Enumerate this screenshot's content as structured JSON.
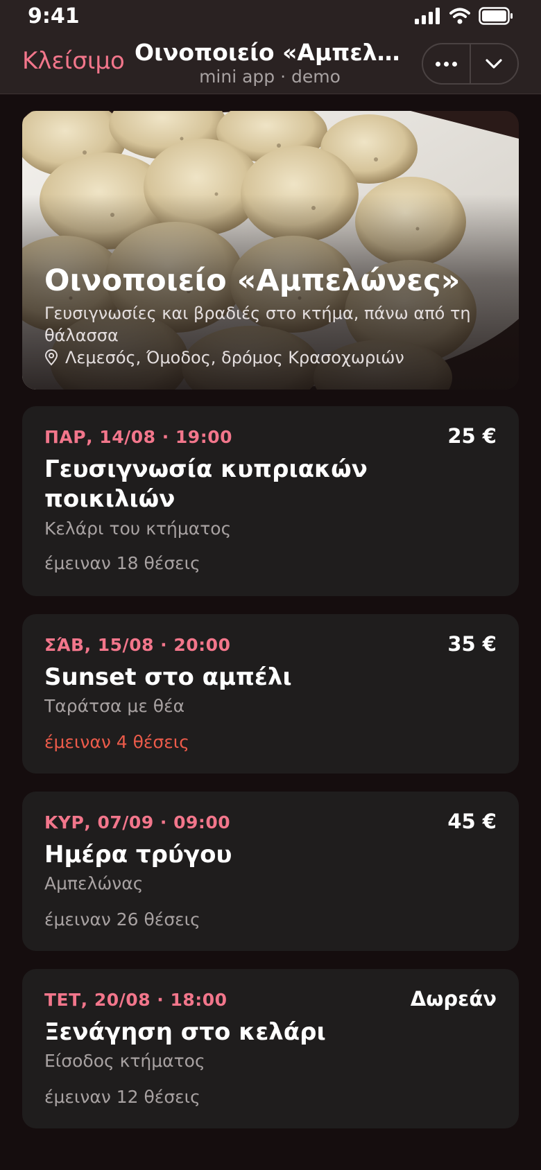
{
  "status_bar": {
    "time": "9:41"
  },
  "header": {
    "close_label": "Κλείσιμο",
    "title": "Οινοποιείο «Αμπελώνες»",
    "subtitle": "mini app · demo",
    "more_icon": "more-dots-icon",
    "collapse_icon": "chevron-down-icon"
  },
  "hero": {
    "title": "Οινοποιείο «Αμπελώνες»",
    "description": "Γευσιγνωσίες και βραδιές στο κτήμα, πάνω από τη θάλασσα",
    "location": "Λεμεσός, Όμοδος, δρόμος Κρασοχωριών",
    "location_icon": "map-pin-icon"
  },
  "events": [
    {
      "date": "ΠΑΡ, 14/08 · 19:00",
      "price": "25 €",
      "title": "Γευσιγνωσία κυπριακών ποικιλιών",
      "place": "Κελάρι του κτήματος",
      "seats": "έμειναν 18 θέσεις"
    },
    {
      "date": "ΣΆΒ, 15/08 · 20:00",
      "price": "35 €",
      "title": "Sunset στο αμπέλι",
      "place": "Ταράτσα με θέα",
      "seats": "έμειναν 4 θέσεις"
    },
    {
      "date": "ΚΥΡ, 07/09 · 09:00",
      "price": "45 €",
      "title": "Ημέρα τρύγου",
      "place": "Αμπελώνας",
      "seats": "έμειναν 26 θέσεις"
    },
    {
      "date": "ΤΕΤ, 20/08 · 18:00",
      "price": "Δωρεάν",
      "title": "Ξενάγηση στο κελάρι",
      "place": "Είσοδος κτήματος",
      "seats": "έμειναν 12 θέσεις"
    }
  ],
  "colors": {
    "accent": "#f2768b",
    "low_seats": "#ec5b4a",
    "card_bg": "#1f1d1d",
    "page_bg": "#150d0e"
  }
}
